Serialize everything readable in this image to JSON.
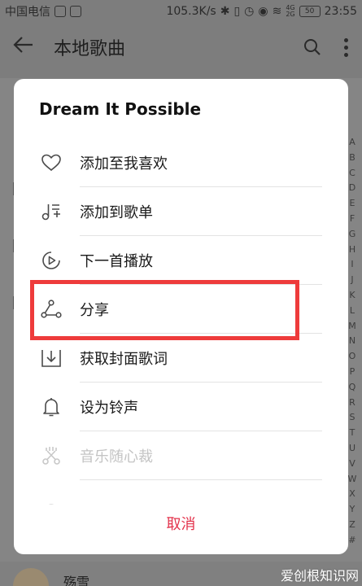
{
  "status_bar": {
    "carrier": "中国电信",
    "speed": "105.3K/s",
    "battery": "50",
    "signal_labels": [
      "4G",
      "2G"
    ],
    "time": "23:55"
  },
  "app_bar": {
    "back_icon": "arrow-left-icon",
    "title": "本地歌曲",
    "search_icon": "search-icon",
    "more_icon": "more-vertical-icon"
  },
  "alphabet_index": [
    "A",
    "B",
    "C",
    "D",
    "E",
    "F",
    "G",
    "H",
    "I",
    "J",
    "K",
    "L",
    "M",
    "N",
    "O",
    "P",
    "Q",
    "R",
    "S",
    "T",
    "U",
    "V",
    "W",
    "X",
    "Y",
    "Z",
    "#"
  ],
  "dialog": {
    "title": "Dream It Possible",
    "items": [
      {
        "label": "添加至我喜欢",
        "icon": "heart-icon",
        "enabled": true
      },
      {
        "label": "添加到歌单",
        "icon": "add-to-playlist-icon",
        "enabled": true
      },
      {
        "label": "下一首播放",
        "icon": "play-next-icon",
        "enabled": true
      },
      {
        "label": "分享",
        "icon": "share-icon",
        "enabled": true
      },
      {
        "label": "获取封面歌词",
        "icon": "download-icon",
        "enabled": true
      },
      {
        "label": "设为铃声",
        "icon": "bell-icon",
        "enabled": true
      },
      {
        "label": "音乐随心裁",
        "icon": "scissors-icon",
        "enabled": false
      }
    ],
    "cancel_label": "取消"
  },
  "mini_player": {
    "song_title": "殇雪"
  },
  "watermark": "爱创根知识网",
  "colors": {
    "accent": "#e3324b",
    "highlight_box": "#ee3b3b",
    "overlay": "#7d7d7d",
    "disabled_text": "#c4c4c4"
  }
}
